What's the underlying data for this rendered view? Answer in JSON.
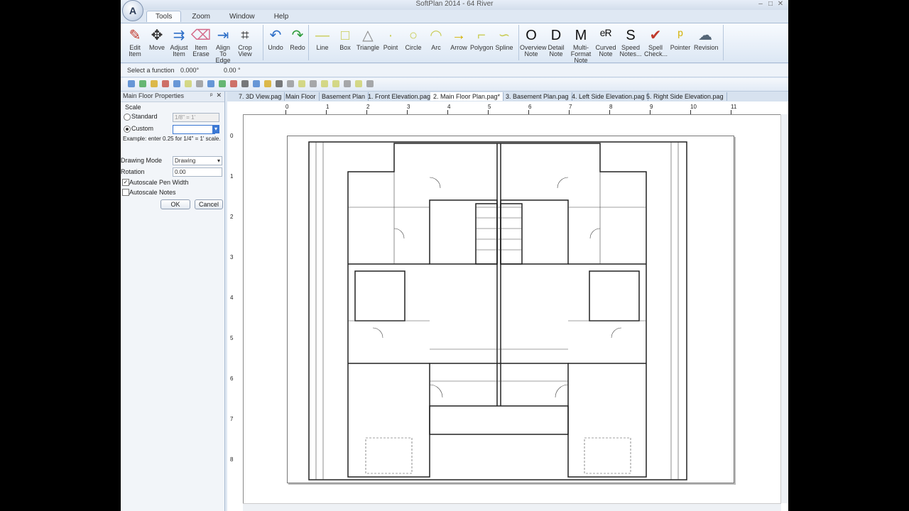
{
  "window": {
    "title": "SoftPlan 2014 - 64 River",
    "controls": [
      "–",
      "□",
      "✕"
    ],
    "app_button": "A"
  },
  "ribbon_tabs": [
    "Tools",
    "Zoom",
    "Window",
    "Help"
  ],
  "ribbon": {
    "edit_group": [
      {
        "label": "Edit\nItem",
        "icon": "edit-item-icon",
        "glyph": "✎",
        "color": "#c0392b"
      },
      {
        "label": "Move",
        "icon": "move-icon",
        "glyph": "✥",
        "color": "#333333"
      },
      {
        "label": "Adjust\nItem",
        "icon": "adjust-item-icon",
        "glyph": "⇉",
        "color": "#2e6fc7"
      },
      {
        "label": "Item\nErase",
        "icon": "eraser-icon",
        "glyph": "⌫",
        "color": "#d46a8a"
      },
      {
        "label": "Align\nTo Edge",
        "icon": "align-icon",
        "glyph": "⇥",
        "color": "#2e6fc7"
      },
      {
        "label": "Crop\nView",
        "icon": "crop-icon",
        "glyph": "⌗",
        "color": "#333333"
      }
    ],
    "undo_group": [
      {
        "label": "Undo",
        "icon": "undo-icon",
        "glyph": "↶",
        "color": "#2e6fc7"
      },
      {
        "label": "Redo",
        "icon": "redo-icon",
        "glyph": "↷",
        "color": "#2e9c3b"
      }
    ],
    "draw_group": [
      {
        "label": "Line",
        "icon": "line-icon",
        "glyph": "—",
        "color": "#c9cc55"
      },
      {
        "label": "Box",
        "icon": "box-icon",
        "glyph": "□",
        "color": "#c9cc55"
      },
      {
        "label": "Triangle",
        "icon": "triangle-icon",
        "glyph": "△",
        "color": "#888888"
      },
      {
        "label": "Point",
        "icon": "point-icon",
        "glyph": "·",
        "color": "#c9cc55"
      },
      {
        "label": "Circle",
        "icon": "circle-icon",
        "glyph": "○",
        "color": "#c9cc55"
      },
      {
        "label": "Arc",
        "icon": "arc-icon",
        "glyph": "◠",
        "color": "#c9cc55"
      },
      {
        "label": "Arrow",
        "icon": "arrow-icon",
        "glyph": "→",
        "color": "#d4b000"
      },
      {
        "label": "Polygon",
        "icon": "polygon-icon",
        "glyph": "⌐",
        "color": "#c9cc55"
      },
      {
        "label": "Spline",
        "icon": "spline-icon",
        "glyph": "∽",
        "color": "#c9cc55"
      }
    ],
    "note_group": [
      {
        "label": "Overview\nNote",
        "icon": "overview-note-icon",
        "glyph": "O",
        "color": "#111111"
      },
      {
        "label": "Detail\nNote",
        "icon": "detail-note-icon",
        "glyph": "D",
        "color": "#111111"
      },
      {
        "label": "Multi-Format\nNote",
        "icon": "multi-format-note-icon",
        "glyph": "M",
        "color": "#111111"
      },
      {
        "label": "Curved\nNote",
        "icon": "curved-note-icon",
        "glyph": "ᵉᴿ",
        "color": "#111111"
      },
      {
        "label": "Speed\nNotes...",
        "icon": "speed-notes-icon",
        "glyph": "S",
        "color": "#111111"
      },
      {
        "label": "Spell\nCheck...",
        "icon": "spell-check-icon",
        "glyph": "✔",
        "color": "#c0392b"
      },
      {
        "label": "Pointer",
        "icon": "pointer-icon",
        "glyph": "ᵖ",
        "color": "#d4b000"
      },
      {
        "label": "Revision",
        "icon": "revision-icon",
        "glyph": "☁",
        "color": "#556677"
      }
    ]
  },
  "status": {
    "prompt": "Select a function",
    "angle1": "0.000°",
    "angle2": "0.00 °"
  },
  "panel": {
    "title": "Main Floor Properties",
    "pin": "ᵖ",
    "close": "✕",
    "scale_label": "Scale",
    "standard_label": "Standard",
    "standard_value": "1/8\" = 1'",
    "custom_label": "Custom",
    "custom_value": "",
    "example": "Example: enter 0.25 for 1/4\" = 1' scale.",
    "drawing_mode_label": "Drawing Mode",
    "drawing_mode_value": "Drawing",
    "rotation_label": "Rotation",
    "rotation_value": "0.00",
    "autoscale_pen": "Autoscale Pen Width",
    "autoscale_notes": "Autoscale Notes",
    "ok": "OK",
    "cancel": "Cancel"
  },
  "doc_tabs": [
    {
      "label": "7. 3D View.pag",
      "active": false
    },
    {
      "label": "Main Floor",
      "active": false
    },
    {
      "label": "Basement Plan",
      "active": false
    },
    {
      "label": "1. Front Elevation.pag",
      "active": false
    },
    {
      "label": "2. Main Floor Plan.pag*",
      "active": true
    },
    {
      "label": "3. Basement Plan.pag",
      "active": false
    },
    {
      "label": "4. Left Side Elevation.pag",
      "active": false
    },
    {
      "label": "5. Right Side Elevation.pag",
      "active": false
    }
  ],
  "ruler": {
    "h": [
      "0",
      "1",
      "2",
      "3",
      "4",
      "5",
      "6",
      "7",
      "8",
      "9",
      "10",
      "11"
    ],
    "v": [
      "0",
      "1",
      "2",
      "3",
      "4",
      "5",
      "6",
      "7",
      "8"
    ]
  }
}
